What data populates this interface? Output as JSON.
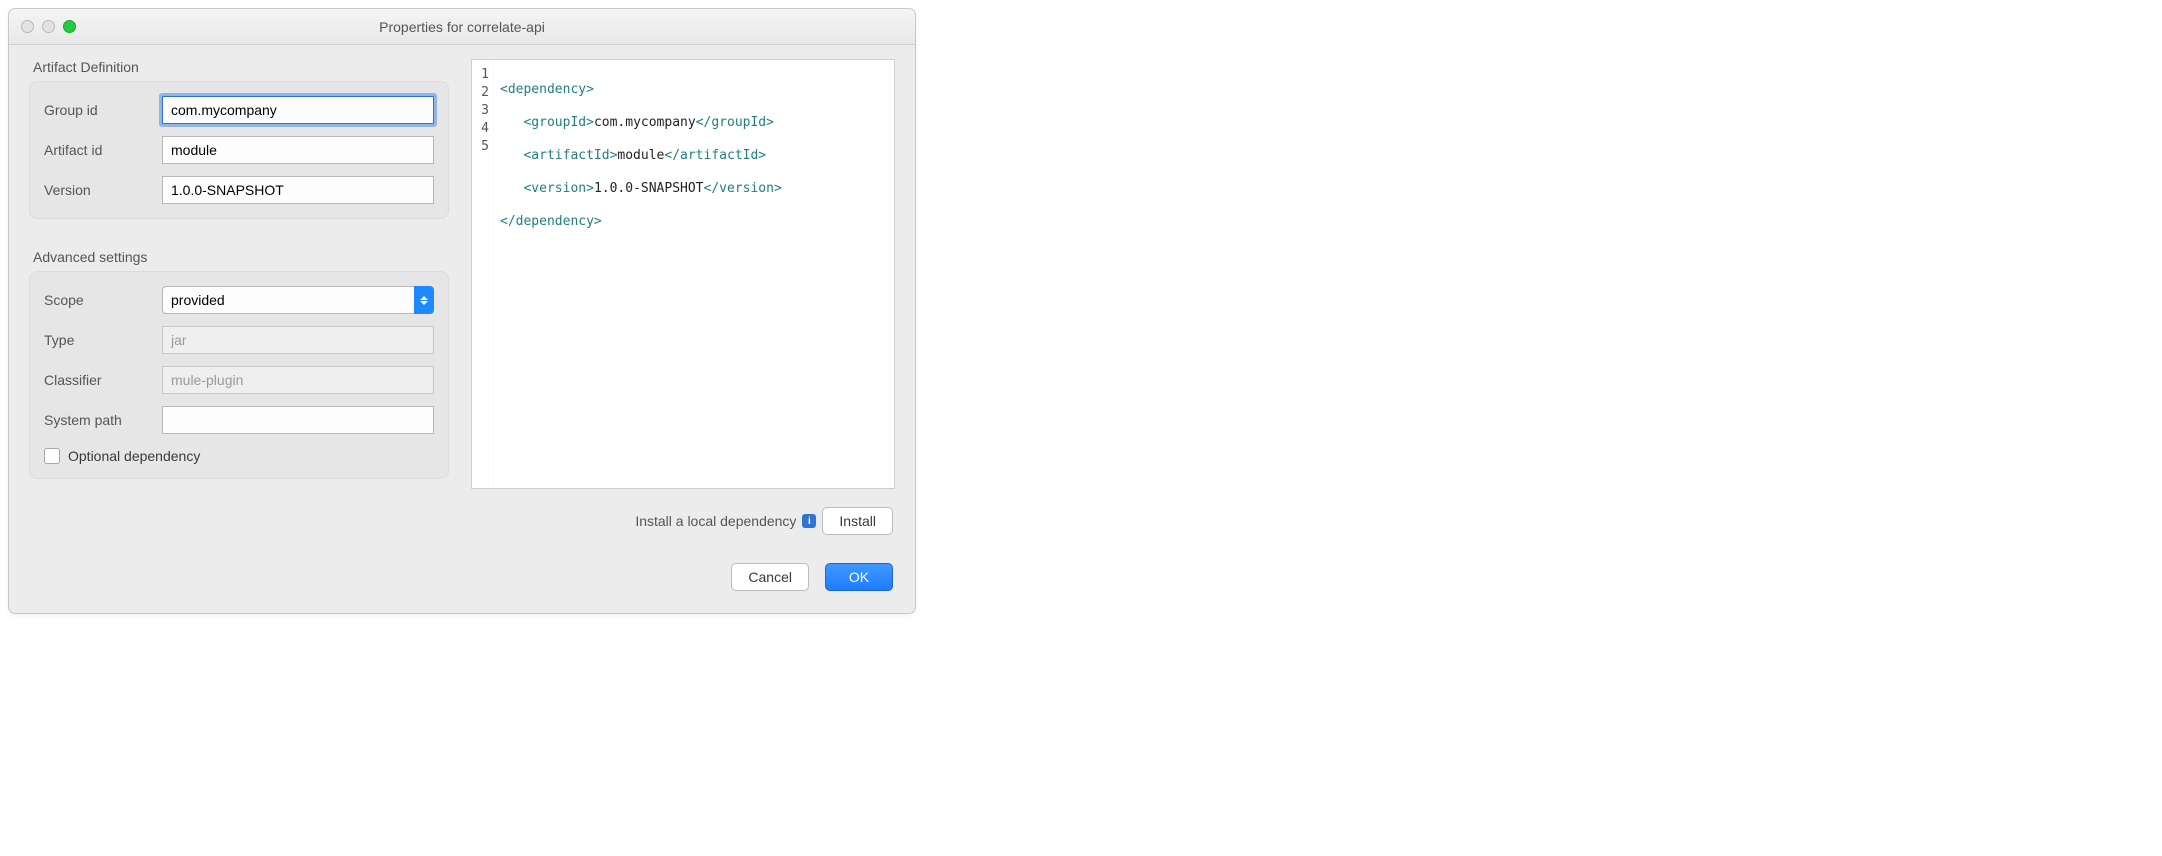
{
  "window": {
    "title": "Properties for correlate-api"
  },
  "artifact": {
    "section_label": "Artifact Definition",
    "group_label": "Group id",
    "group_value": "com.mycompany",
    "artifact_label": "Artifact id",
    "artifact_value": "module",
    "version_label": "Version",
    "version_value": "1.0.0-SNAPSHOT"
  },
  "advanced": {
    "section_label": "Advanced settings",
    "scope_label": "Scope",
    "scope_value": "provided",
    "type_label": "Type",
    "type_placeholder": "jar",
    "classifier_label": "Classifier",
    "classifier_placeholder": "mule-plugin",
    "system_path_label": "System path",
    "system_path_value": "",
    "optional_label": "Optional dependency",
    "optional_checked": false
  },
  "install": {
    "hint": "Install a local dependency",
    "button_label": "Install"
  },
  "dialog_buttons": {
    "cancel_label": "Cancel",
    "ok_label": "OK"
  },
  "xml": {
    "line_numbers": [
      "1",
      "2",
      "3",
      "4",
      "5"
    ],
    "dependency_open": "<dependency>",
    "group_open": "<groupId>",
    "group_text": "com.mycompany",
    "group_close": "</groupId>",
    "artifact_open": "<artifactId>",
    "artifact_text": "module",
    "artifact_close": "</artifactId>",
    "version_open": "<version>",
    "version_text": "1.0.0-SNAPSHOT",
    "version_close": "</version>",
    "dependency_close": "</dependency>"
  }
}
